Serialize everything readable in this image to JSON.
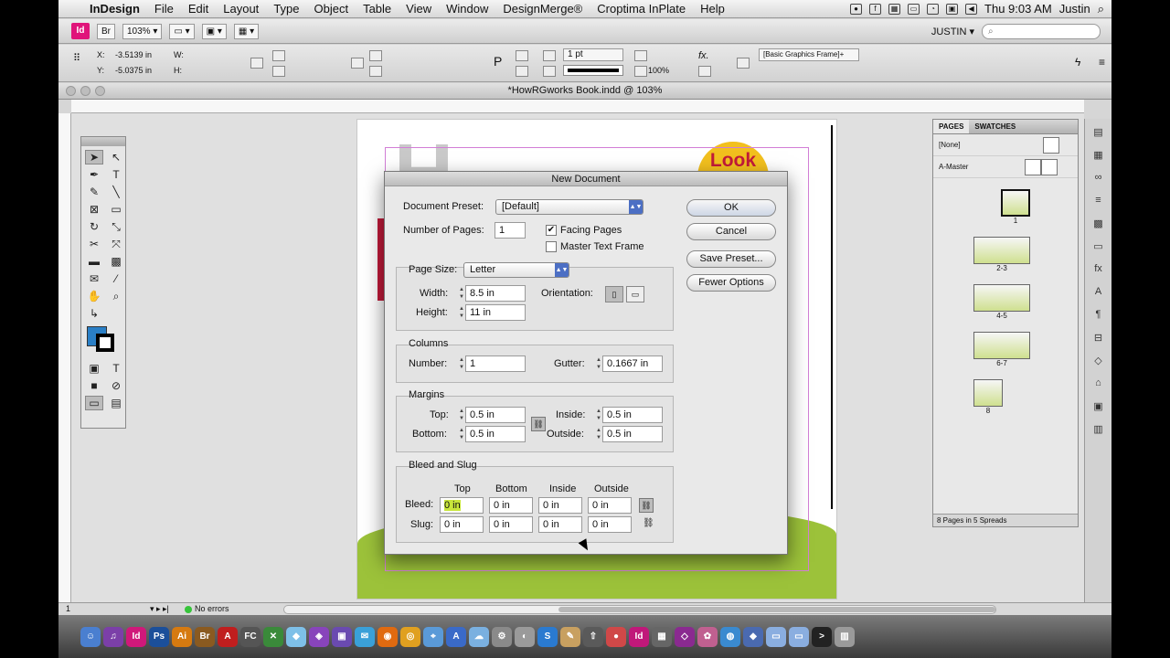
{
  "menubar": {
    "app_name": "InDesign",
    "items": [
      "File",
      "Edit",
      "Layout",
      "Type",
      "Object",
      "Table",
      "View",
      "Window",
      "DesignMerge®",
      "Croptima InPlate",
      "Help"
    ],
    "clock": "Thu 9:03 AM",
    "user": "Justin"
  },
  "appbar": {
    "logo": "Id",
    "br": "Br",
    "zoom": "103%",
    "workspace": "JUSTIN"
  },
  "control": {
    "x_label": "X:",
    "x_value": "-3.5139 in",
    "y_label": "Y:",
    "y_value": "-5.0375 in",
    "w_label": "W:",
    "h_label": "H:",
    "stroke_weight": "1 pt",
    "scale": "100%",
    "frame_style": "[Basic Graphics Frame]+"
  },
  "document": {
    "title": "*HowRGworks Book.indd @ 103%"
  },
  "page_art": {
    "look": "Look"
  },
  "pages_panel": {
    "tab_pages": "PAGES",
    "tab_swatches": "SWATCHES",
    "none_master": "[None]",
    "a_master": "A-Master",
    "spreads": [
      "1",
      "2-3",
      "4-5",
      "6-7",
      "8"
    ],
    "footer": "8 Pages in 5 Spreads"
  },
  "status": {
    "page_field": "1",
    "errors": "No errors"
  },
  "dialog": {
    "title": "New Document",
    "preset_label": "Document Preset:",
    "preset_value": "[Default]",
    "pages_label": "Number of Pages:",
    "pages_value": "1",
    "facing_label": "Facing Pages",
    "master_label": "Master Text Frame",
    "page_size_label": "Page Size:",
    "page_size_value": "Letter",
    "width_label": "Width:",
    "width_value": "8.5 in",
    "height_label": "Height:",
    "height_value": "11 in",
    "orientation_label": "Orientation:",
    "columns_title": "Columns",
    "number_label": "Number:",
    "number_value": "1",
    "gutter_label": "Gutter:",
    "gutter_value": "0.1667 in",
    "margins_title": "Margins",
    "top_label": "Top:",
    "top_value": "0.5 in",
    "bottom_label": "Bottom:",
    "bottom_value": "0.5 in",
    "inside_label": "Inside:",
    "inside_value": "0.5 in",
    "outside_label": "Outside:",
    "outside_value": "0.5 in",
    "bleed_title": "Bleed and Slug",
    "col_top": "Top",
    "col_bottom": "Bottom",
    "col_inside": "Inside",
    "col_outside": "Outside",
    "bleed_label": "Bleed:",
    "slug_label": "Slug:",
    "bleed_values": [
      "0 in",
      "0 in",
      "0 in",
      "0 in"
    ],
    "slug_values": [
      "0 in",
      "0 in",
      "0 in",
      "0 in"
    ],
    "ok": "OK",
    "cancel": "Cancel",
    "save_preset": "Save Preset...",
    "fewer_options": "Fewer Options"
  }
}
